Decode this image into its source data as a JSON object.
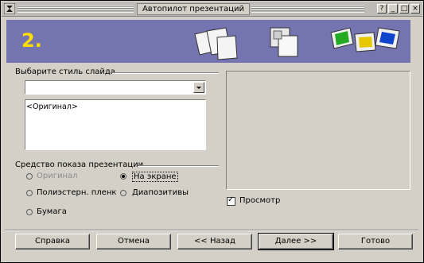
{
  "window": {
    "title": "Автопилот презентаций",
    "buttons": [
      "?",
      "_",
      "□",
      "×"
    ]
  },
  "header": {
    "step": "2.",
    "icons": [
      "slides-stack-icon",
      "slide-layout-icon",
      "color-slides-icon"
    ]
  },
  "style_section": {
    "label": "Выбарите стиль слайда",
    "combo_value": "",
    "list_items": [
      "<Оригинал>"
    ]
  },
  "presentation_section": {
    "label": "Средство показа презентации",
    "options": [
      {
        "label": "Оригинал",
        "selected": false,
        "disabled": true
      },
      {
        "label": "На экране",
        "selected": true,
        "disabled": false
      },
      {
        "label": "Полиэстерн. пленк",
        "selected": false,
        "disabled": false
      },
      {
        "label": "Диапозитивы",
        "selected": false,
        "disabled": false
      },
      {
        "label": "Бумага",
        "selected": false,
        "disabled": false
      }
    ]
  },
  "preview_checkbox": {
    "label": "Просмотр",
    "checked": true
  },
  "footer": {
    "help": "Справка",
    "cancel": "Отмена",
    "back": "<< Назад",
    "next": "Далее >>",
    "finish": "Готово"
  },
  "colors": {
    "banner": "#7474b0",
    "step": "#ffde00",
    "face": "#d4d0c8"
  }
}
